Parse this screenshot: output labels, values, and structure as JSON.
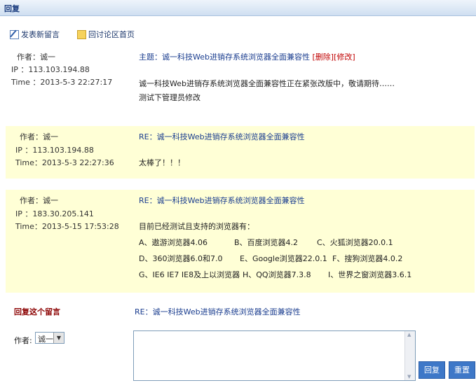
{
  "window": {
    "title": "回复"
  },
  "toolbar": {
    "new_post": "发表新留言",
    "forum_home": "回讨论区首页"
  },
  "posts": [
    {
      "author": "作者：诚一",
      "ip": "IP ：113.103.194.88",
      "time": "Time ：2013-5-3 22:27:17",
      "subject": "主题：诚一科技Web进销存系统浏览器全面兼容性",
      "delete_label": "[删除]",
      "edit_label": "[修改]",
      "lines": [
        "诚一科技Web进销存系统浏览器全面兼容性正在紧张改版中，敬请期待……",
        "测试下管理员修改"
      ]
    },
    {
      "author": "作者：诚一",
      "ip": "IP ：113.103.194.88",
      "time": "Time：2013-5-3 22:27:36",
      "subject": "RE：诚一科技Web进销存系统浏览器全面兼容性",
      "lines": [
        "太棒了！！！"
      ]
    },
    {
      "author": "作者：诚一",
      "ip": "IP ：183.30.205.141",
      "time": "Time：2013-5-15 17:53:28",
      "subject": "RE：诚一科技Web进销存系统浏览器全面兼容性",
      "lines": [
        "目前已经测试且支持的浏览器有：",
        "A、遨游浏览器4.06",
        "B、百度浏览器4.2",
        "C、火狐浏览器20.0.1",
        "D、360浏览器6.0和7.0",
        "E、Google浏览器22.0.1",
        "F、搜狗浏览器4.0.2",
        "G、IE6 IE7 IE8及上以浏览器",
        "H、QQ浏览器7.3.8",
        "I、世界之窗浏览器3.6.1"
      ]
    }
  ],
  "reply_form": {
    "label": "回复这个留言",
    "subject": "RE：诚一科技Web进销存系统浏览器全面兼容性",
    "author_label": "作者:",
    "author_value": "诚一",
    "reply_button": "回复",
    "reset_button": "重置"
  },
  "colors": {
    "post_highlight": "#ffffd6",
    "accent_red": "#c00000",
    "button_blue": "#3e78c8"
  }
}
